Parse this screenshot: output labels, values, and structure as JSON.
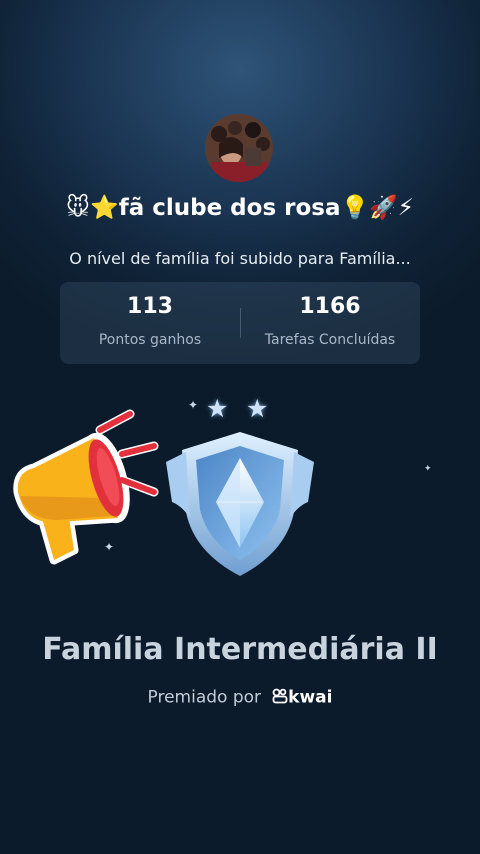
{
  "group": {
    "name_emojis_left": "🐭⭐",
    "name": "fã clube dos rosa",
    "name_emojis_right": "💡🚀⚡"
  },
  "level_message": "O nível de família foi subido para Família...",
  "stats": [
    {
      "value": "113",
      "label": "Pontos ganhos"
    },
    {
      "value": "1166",
      "label": "Tarefas Concluídas"
    }
  ],
  "badge": {
    "stars": [
      "★",
      "★"
    ],
    "tier_name": "Família Intermediária II"
  },
  "awarded": {
    "prefix": "Premiado por",
    "brand": "kwai"
  },
  "icons": [
    "megaphone-icon",
    "shield-badge-icon",
    "star-icon",
    "kwai-logo-icon",
    "sparkle-icon"
  ],
  "colors": {
    "background_top": "#2e5478",
    "background_bottom": "#0b1b2b",
    "text_primary": "#ffffff",
    "text_muted": "#a9b8c8",
    "megaphone_yellow": "#f9b21a",
    "megaphone_red": "#e2303c",
    "badge_blue": "#a9d1f5"
  }
}
